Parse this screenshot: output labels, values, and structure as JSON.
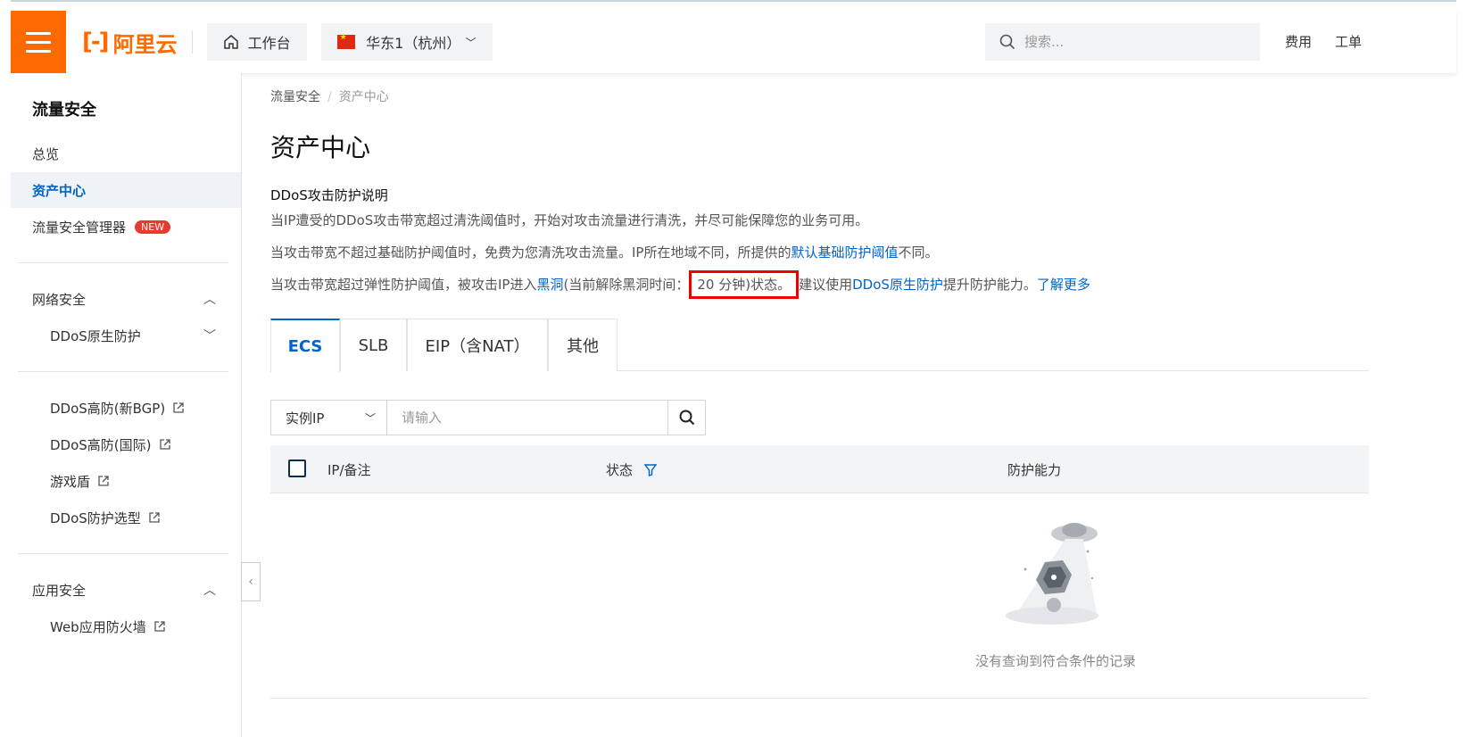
{
  "topbar": {
    "logo_text": "阿里云",
    "workbench_label": "工作台",
    "region_label": "华东1（杭州）",
    "search_placeholder": "搜索...",
    "links": [
      "费用",
      "工单"
    ],
    "brand_color": "#ff6a00"
  },
  "sidebar": {
    "title": "流量安全",
    "items": [
      {
        "label": "总览"
      },
      {
        "label": "资产中心",
        "active": true
      },
      {
        "label": "流量安全管理器",
        "badge": "NEW"
      }
    ],
    "groups": [
      {
        "label": "网络安全",
        "expanded": true,
        "items": [
          "DDoS原生防护"
        ]
      },
      {
        "label": "",
        "items": [
          "DDoS高防(新BGP)",
          "DDoS高防(国际)",
          "游戏盾",
          "DDoS防护选型"
        ]
      },
      {
        "label": "应用安全",
        "expanded": true,
        "items": [
          "Web应用防火墙"
        ]
      }
    ]
  },
  "main": {
    "breadcrumb": [
      "流量安全",
      "资产中心"
    ],
    "title": "资产中心",
    "desc_title": "DDoS攻击防护说明",
    "desc1": "当IP遭受的DDoS攻击带宽超过清洗阈值时，开始对攻击流量进行清洗，并尽可能保障您的业务可用。",
    "desc2_pre": "当攻击带宽不超过基础防护阈值时，免费为您清洗攻击流量。IP所在地域不同，所提供的",
    "desc2_link": "默认基础防护阈值",
    "desc2_post": "不同。",
    "desc3_pre": "当攻击带宽超过弹性防护阈值，被攻击IP进入",
    "desc3_link1": "黑洞",
    "desc3_mid": "(当前解除黑洞时间：",
    "desc3_highlight": "20 分钟)状态。",
    "desc3_post": "建议使用",
    "desc3_link2": "DDoS原生防护",
    "desc3_post2": "提升防护能力。",
    "desc3_link3": "了解更多",
    "tabs": [
      "ECS",
      "SLB",
      "EIP（含NAT）",
      "其他"
    ],
    "filter_select": "实例IP",
    "filter_placeholder": "请输入",
    "columns": [
      "IP/备注",
      "状态",
      "防护能力"
    ],
    "empty_text": "没有查询到符合条件的记录"
  }
}
